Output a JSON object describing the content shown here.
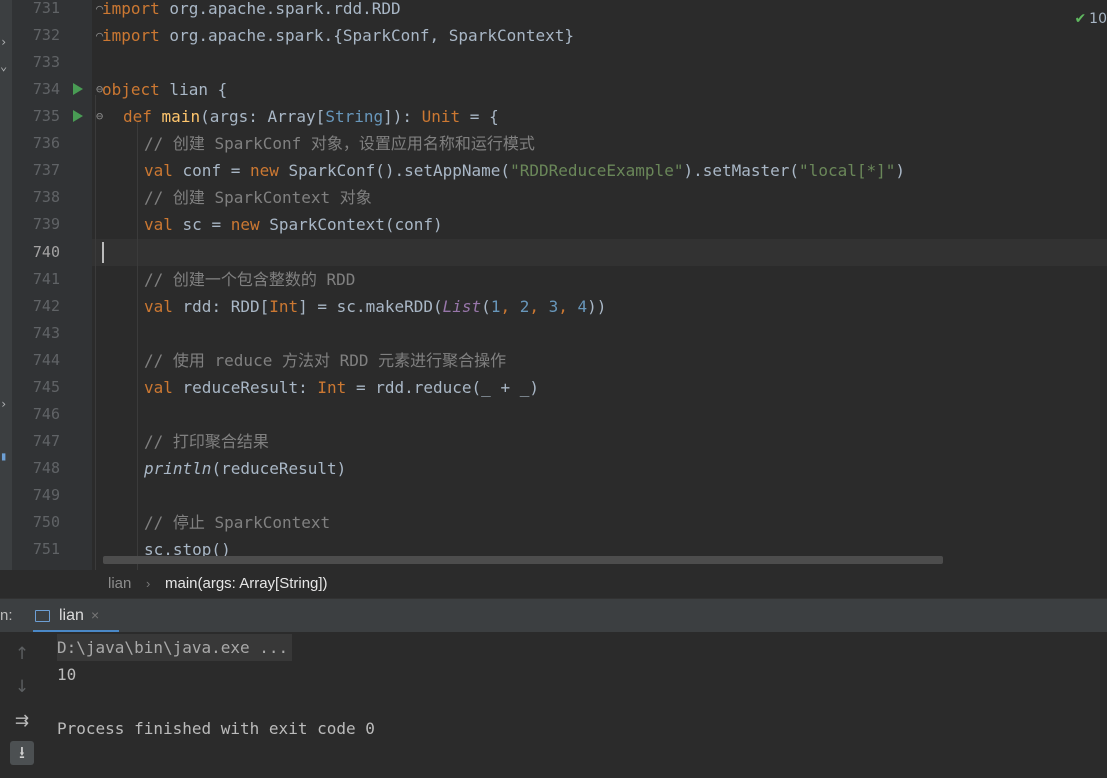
{
  "editor": {
    "line_numbers": [
      "731",
      "732",
      "733",
      "734",
      "735",
      "736",
      "737",
      "738",
      "739",
      "740",
      "741",
      "742",
      "743",
      "744",
      "745",
      "746",
      "747",
      "748",
      "749",
      "750",
      "751"
    ],
    "current_line": "740",
    "lines": {
      "l731": {
        "kw": "import",
        "rest": " org.apache.spark.rdd.RDD"
      },
      "l732": {
        "kw": "import",
        "rest": " org.apache.spark.{SparkConf, SparkContext}"
      },
      "l734": {
        "kw": "object",
        "rest": " lian {"
      },
      "l735": {
        "kw": "def",
        "fn": "main",
        "p1": "(args: Array[",
        "ty": "String",
        "p2": "]): ",
        "unit": "Unit",
        "p3": " = {"
      },
      "l736": {
        "cmt": "// 创建 SparkConf 对象，设置应用名称和运行模式"
      },
      "l737": {
        "kw": "val",
        "p1": " conf = ",
        "kw2": "new",
        "p2": " SparkConf().setAppName(",
        "s1": "\"RDDReduceExample\"",
        "p3": ").setMaster(",
        "s2": "\"local[*]\"",
        "p4": ")"
      },
      "l738": {
        "cmt": "// 创建 SparkContext 对象"
      },
      "l739": {
        "kw": "val",
        "p1": " sc = ",
        "kw2": "new",
        "p2": " SparkContext(conf)"
      },
      "l741": {
        "cmt": "// 创建一个包含整数的 RDD"
      },
      "l742": {
        "kw": "val",
        "p1": " rdd: RDD[",
        "ty": "Int",
        "p2": "] = sc.makeRDD(",
        "list": "List",
        "p3": "(",
        "n1": "1",
        "c1": ", ",
        "n2": "2",
        "c2": ", ",
        "n3": "3",
        "c3": ", ",
        "n4": "4",
        "p4": "))"
      },
      "l744": {
        "cmt": "// 使用 reduce 方法对 RDD 元素进行聚合操作"
      },
      "l745": {
        "kw": "val",
        "p1": " reduceResult: ",
        "ty": "Int",
        "p2": " = rdd.reduce(_ + _)"
      },
      "l747": {
        "cmt": "// 打印聚合结果"
      },
      "l748": {
        "fn": "println",
        "p1": "(reduceResult)"
      },
      "l750": {
        "cmt": "// 停止 SparkContext"
      },
      "l751": {
        "p1": "sc.stop()"
      }
    },
    "inspection_count": "10"
  },
  "breadcrumb": {
    "items": [
      "lian",
      "main(args: Array[String])"
    ],
    "separator": "›"
  },
  "run_panel": {
    "label": "n:",
    "tab_label": "lian",
    "tab_close": "×",
    "console_lines": [
      "D:\\java\\bin\\java.exe ...",
      "10",
      "",
      "Process finished with exit code 0"
    ]
  },
  "icons": {
    "run": "run-gutter-icon",
    "fold": "fold-icon",
    "inspection": "check-icon",
    "up": "arrow-up-icon",
    "down": "arrow-down-icon",
    "wrap": "soft-wrap-icon",
    "scroll_end": "scroll-to-end-icon"
  },
  "colors": {
    "background": "#2b2b2b",
    "keyword": "#cc7832",
    "function": "#ffc66d",
    "string": "#6a8759",
    "number": "#6897bb",
    "comment": "#808080",
    "run_icon": "#499c54",
    "tab_underline": "#4a88c7"
  }
}
